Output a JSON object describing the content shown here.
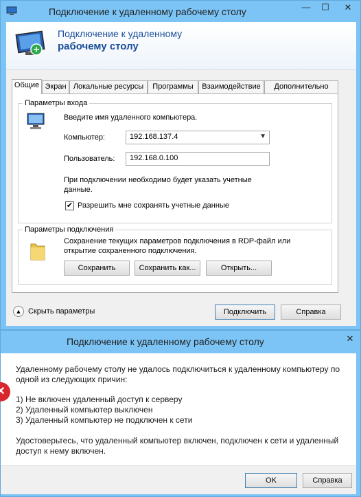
{
  "window": {
    "title": "Подключение к удаленному рабочему столу",
    "minimize": "—",
    "maximize": "☐",
    "close": "✕"
  },
  "banner": {
    "line1": "Подключение к удаленному",
    "line2": "рабочему столу"
  },
  "tabs": [
    "Общие",
    "Экран",
    "Локальные ресурсы",
    "Программы",
    "Взаимодействие",
    "Дополнительно"
  ],
  "login": {
    "group_label": "Параметры входа",
    "prompt": "Введите имя удаленного компьютера.",
    "computer_label": "Компьютер:",
    "computer_value": "192.168.137.4",
    "user_label": "Пользователь:",
    "user_value": "192.168.0.100",
    "note_line1": "При подключении необходимо будет указать учетные",
    "note_line2": "данные.",
    "save_creds_label": "Разрешить мне сохранять учетные данные",
    "save_creds_checked": "✔"
  },
  "connection": {
    "group_label": "Параметры подключения",
    "desc_line1": "Сохранение текущих параметров подключения в RDP-файл или",
    "desc_line2": "открытие сохраненного подключения.",
    "save_button": "Сохранить",
    "save_as_button": "Сохранить как...",
    "open_button": "Открыть..."
  },
  "footer": {
    "hide_options": "Скрыть параметры",
    "toggle_glyph": "▲",
    "connect_button": "Подключить",
    "help_button": "Справка"
  },
  "error_dialog": {
    "title": "Подключение к удаленному рабочему столу",
    "close": "✕",
    "icon_glyph": "✕",
    "line1": "Удаленному рабочему столу не удалось подключиться к удаленному компьютеру по",
    "line2": "одной из следующих причин:",
    "reason1": "1) Не включен удаленный доступ к серверу",
    "reason2": "2) Удаленный компьютер выключен",
    "reason3": "3) Удаленный компьютер не подключен к сети",
    "advice1": "Удостоверьтесь, что удаленный компьютер включен, подключен к сети и удаленный",
    "advice2": "доступ к нему включен.",
    "ok_button": "OK",
    "help_button": "Справка"
  },
  "colors": {
    "titlebar": "#7cc4f5",
    "banner_text": "#1a4e9a",
    "error_red": "#d9262e"
  }
}
